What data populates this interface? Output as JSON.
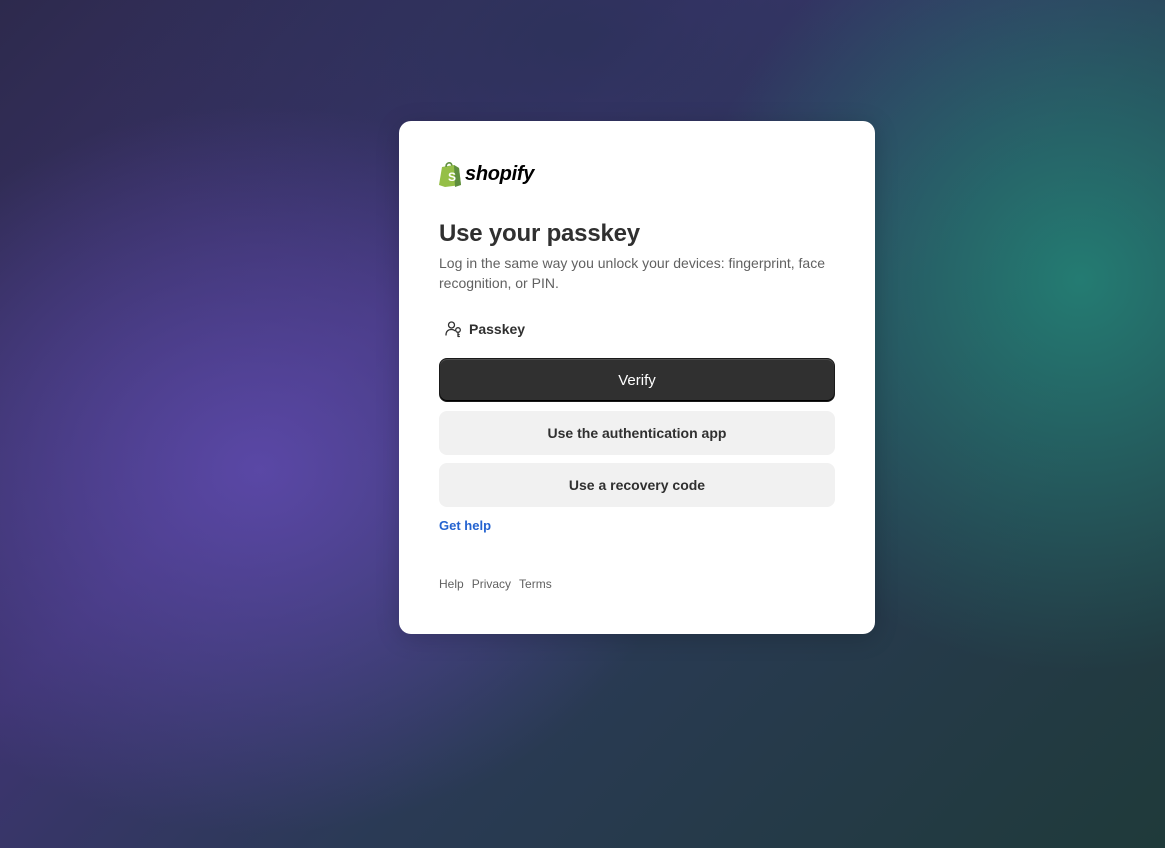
{
  "brand": {
    "name": "shopify",
    "logo_icon": "shopify-bag-icon",
    "accent_color": "#95bf47"
  },
  "auth": {
    "title": "Use your passkey",
    "subtitle": "Log in the same way you unlock your devices: fingerprint, face recognition, or PIN.",
    "method": {
      "icon": "passkey-icon",
      "label": "Passkey"
    },
    "verify_label": "Verify",
    "auth_app_label": "Use the authentication app",
    "recovery_label": "Use a recovery code",
    "get_help_label": "Get help"
  },
  "footer": {
    "links": [
      "Help",
      "Privacy",
      "Terms"
    ]
  },
  "colors": {
    "primary_button": "#303030",
    "secondary_button": "#f1f1f1",
    "link": "#2463d0"
  }
}
